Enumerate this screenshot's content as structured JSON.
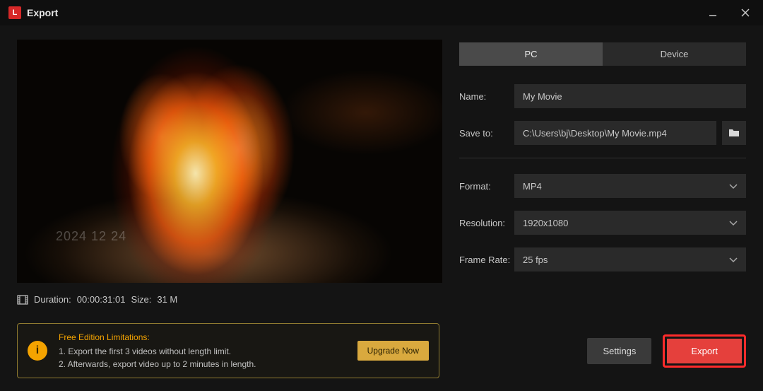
{
  "titlebar": {
    "title": "Export"
  },
  "preview": {
    "watermark": "2024    12  24",
    "duration_label": "Duration:",
    "duration_value": "00:00:31:01",
    "size_label": "Size:",
    "size_value": "31 M"
  },
  "tabs": {
    "pc": "PC",
    "device": "Device"
  },
  "form": {
    "name_label": "Name:",
    "name_value": "My Movie",
    "saveto_label": "Save to:",
    "saveto_value": "C:\\Users\\bj\\Desktop\\My Movie.mp4",
    "format_label": "Format:",
    "format_value": "MP4",
    "resolution_label": "Resolution:",
    "resolution_value": "1920x1080",
    "framerate_label": "Frame Rate:",
    "framerate_value": "25 fps"
  },
  "limitations": {
    "title": "Free Edition Limitations:",
    "line1": "1. Export the first 3 videos without length limit.",
    "line2": "2. Afterwards, export video up to 2 minutes in length.",
    "upgrade": "Upgrade Now"
  },
  "footer": {
    "settings": "Settings",
    "export": "Export"
  }
}
